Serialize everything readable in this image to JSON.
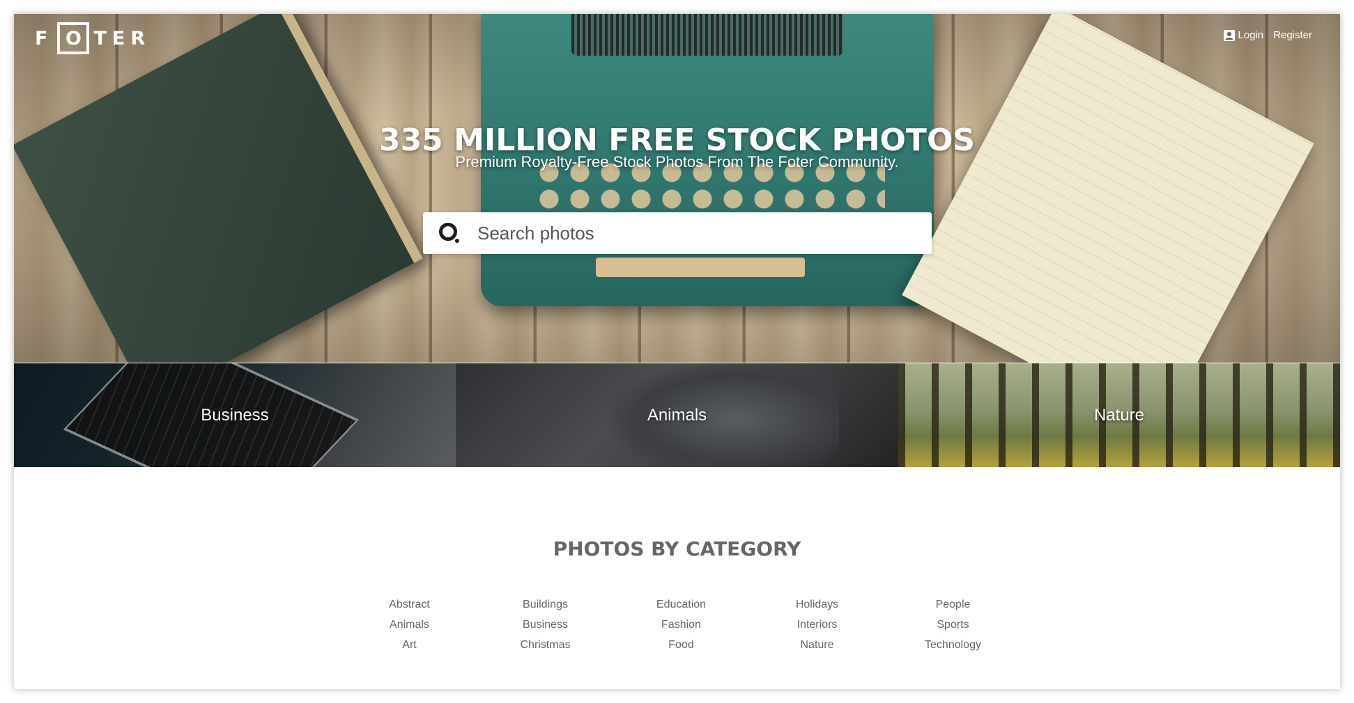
{
  "logo": {
    "letters_left": "F",
    "letter_box": "O",
    "letters_right": "TER"
  },
  "auth": {
    "login_label": "Login",
    "register_label": "Register"
  },
  "hero": {
    "headline": "335 MILLION FREE STOCK PHOTOS",
    "subline": "Premium Royalty-Free Stock Photos From The Foter Community."
  },
  "search": {
    "placeholder": "Search photos",
    "value": ""
  },
  "tiles": [
    {
      "label": "Business"
    },
    {
      "label": "Animals"
    },
    {
      "label": "Nature"
    }
  ],
  "categories": {
    "title": "PHOTOS BY CATEGORY",
    "columns": [
      [
        "Abstract",
        "Animals",
        "Art"
      ],
      [
        "Buildings",
        "Business",
        "Christmas"
      ],
      [
        "Education",
        "Fashion",
        "Food"
      ],
      [
        "Holidays",
        "Interiors",
        "Nature"
      ],
      [
        "People",
        "Sports",
        "Technology"
      ]
    ]
  },
  "colors": {
    "text_gray": "#666666",
    "white": "#ffffff"
  },
  "icons": {
    "search": "search-icon",
    "user": "user-icon"
  }
}
